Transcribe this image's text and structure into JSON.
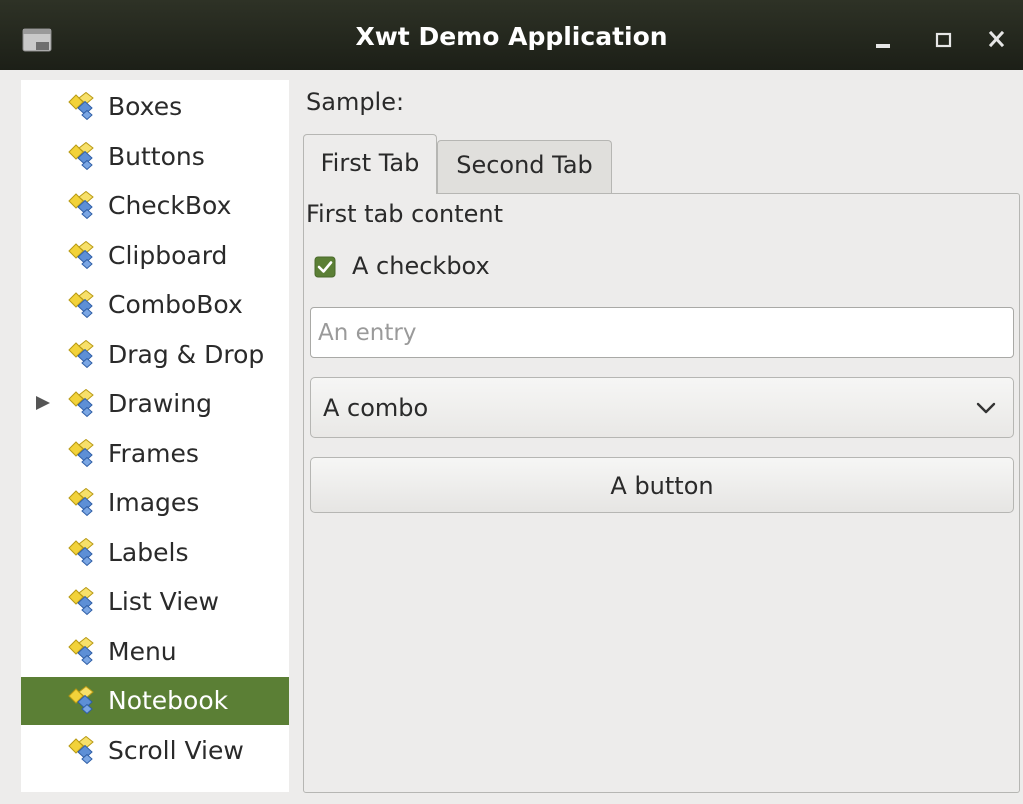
{
  "window": {
    "title": "Xwt Demo Application"
  },
  "sidebar": {
    "items": [
      {
        "label": "Boxes"
      },
      {
        "label": "Buttons"
      },
      {
        "label": "CheckBox"
      },
      {
        "label": "Clipboard"
      },
      {
        "label": "ComboBox"
      },
      {
        "label": "Drag & Drop"
      },
      {
        "label": "Drawing",
        "has_children": true
      },
      {
        "label": "Frames"
      },
      {
        "label": "Images"
      },
      {
        "label": "Labels"
      },
      {
        "label": "List View"
      },
      {
        "label": "Menu"
      },
      {
        "label": "Notebook",
        "selected": true
      },
      {
        "label": "Scroll View"
      }
    ],
    "item_icon": "widget-diamond-icon"
  },
  "sample": {
    "label": "Sample:",
    "tabs": [
      {
        "label": "First Tab",
        "active": true
      },
      {
        "label": "Second Tab",
        "active": false
      }
    ],
    "page": {
      "text": "First tab content",
      "checkbox": {
        "label": "A checkbox",
        "checked": true
      },
      "entry": {
        "value": "",
        "placeholder": "An entry"
      },
      "combo": {
        "value": "A combo"
      },
      "button": {
        "label": "A button"
      }
    }
  },
  "colors": {
    "selection": "#5b7f35",
    "checkbox_check": "#5b7f35",
    "titlebar": "#23271d"
  }
}
